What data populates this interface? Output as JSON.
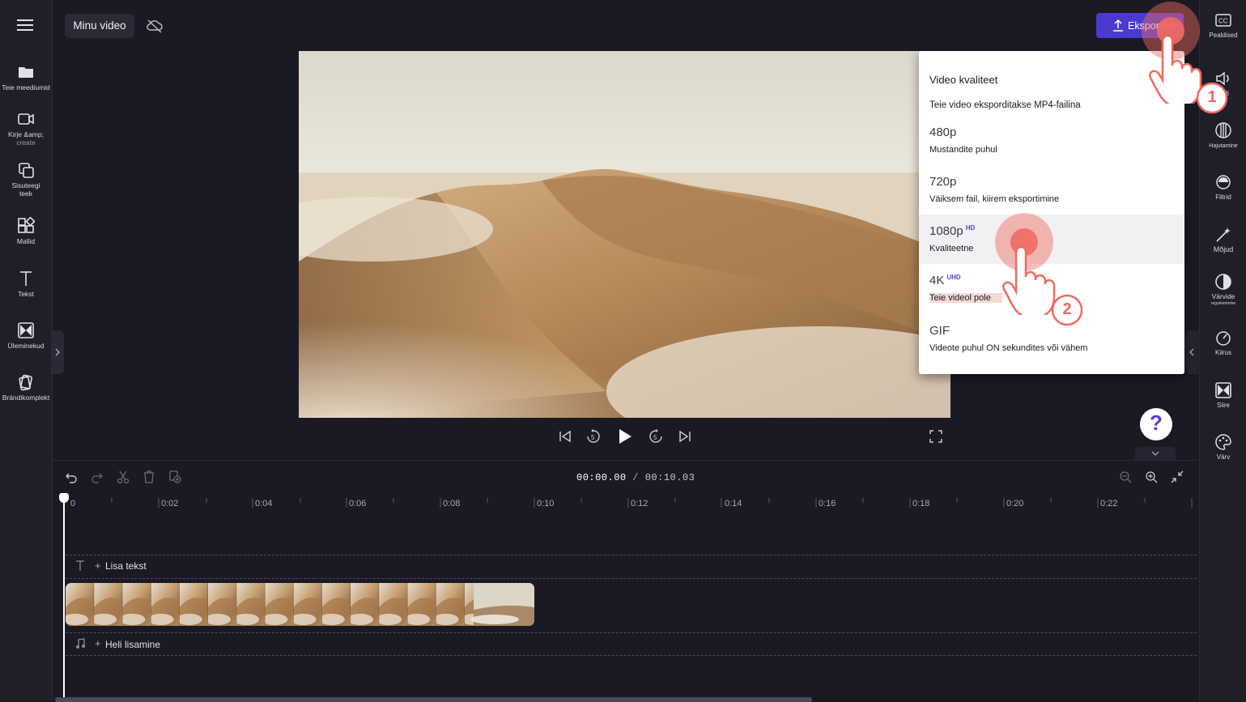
{
  "header": {
    "project_name": "Minu video",
    "export_label": "Ekspordi"
  },
  "left_sidebar": {
    "items": [
      {
        "label": "Teie meediumid",
        "icon": "folder-icon"
      },
      {
        "label": "Kirje &amp;",
        "sub": "create",
        "icon": "record-camera-icon"
      },
      {
        "label": "Sisuteegi",
        "sub": "teek",
        "icon": "content-library-icon"
      },
      {
        "label": "Mallid",
        "icon": "templates-icon"
      },
      {
        "label": "Tekst",
        "icon": "text-icon"
      },
      {
        "label": "Üleminekud",
        "icon": "transitions-icon"
      },
      {
        "label": "Brändikomplekt",
        "icon": "brand-kit-icon"
      }
    ]
  },
  "right_sidebar": {
    "items": [
      {
        "label": "Pealdised",
        "icon": "captions-icon"
      },
      {
        "label": "Heli",
        "icon": "audio-icon"
      },
      {
        "label": "Hajutamine",
        "icon": "fade-icon"
      },
      {
        "label": "Filtrid",
        "icon": "filters-icon"
      },
      {
        "label": "Mõjud",
        "icon": "effects-wand-icon"
      },
      {
        "label": "Värvide",
        "sub": "reguleerimine",
        "icon": "color-adjust-icon"
      },
      {
        "label": "Kiirus",
        "icon": "speed-icon"
      },
      {
        "label": "Siire",
        "icon": "transition-icon"
      },
      {
        "label": "Värv",
        "icon": "palette-icon"
      }
    ]
  },
  "export_menu": {
    "title": "Video kvaliteet",
    "subtitle": "Teie video eksporditakse MP4-failina",
    "options": [
      {
        "name": "480p",
        "desc": "Mustandite puhul",
        "badge": ""
      },
      {
        "name": "720p",
        "desc": "Väiksem fail, kiirem eksportimine",
        "badge": ""
      },
      {
        "name": "1080p",
        "desc": "Kvaliteetne",
        "badge": "HD"
      },
      {
        "name": "4K",
        "desc": "Teie videol pole",
        "badge": "UHD"
      },
      {
        "name": "GIF",
        "desc": "Videote puhul ON sekundites või vähem",
        "badge": ""
      }
    ]
  },
  "player": {
    "time_current": "00:00.00",
    "time_separator": " / ",
    "time_total": "00:10.03"
  },
  "timeline": {
    "ticks": [
      "0",
      "0:02",
      "0:04",
      "0:06",
      "0:08",
      "0:10",
      "0:12",
      "0:14",
      "0:16",
      "0:18",
      "0:20",
      "0:22"
    ],
    "text_track_label": "Lisa tekst",
    "audio_track_label": "Heli lisamine"
  },
  "annotations": {
    "step1": "1",
    "step2": "2"
  },
  "colors": {
    "accent": "#4a3bd0",
    "badge": "#5a3fd6",
    "tap_marker": "#f06a60",
    "background": "#1a1a24"
  }
}
